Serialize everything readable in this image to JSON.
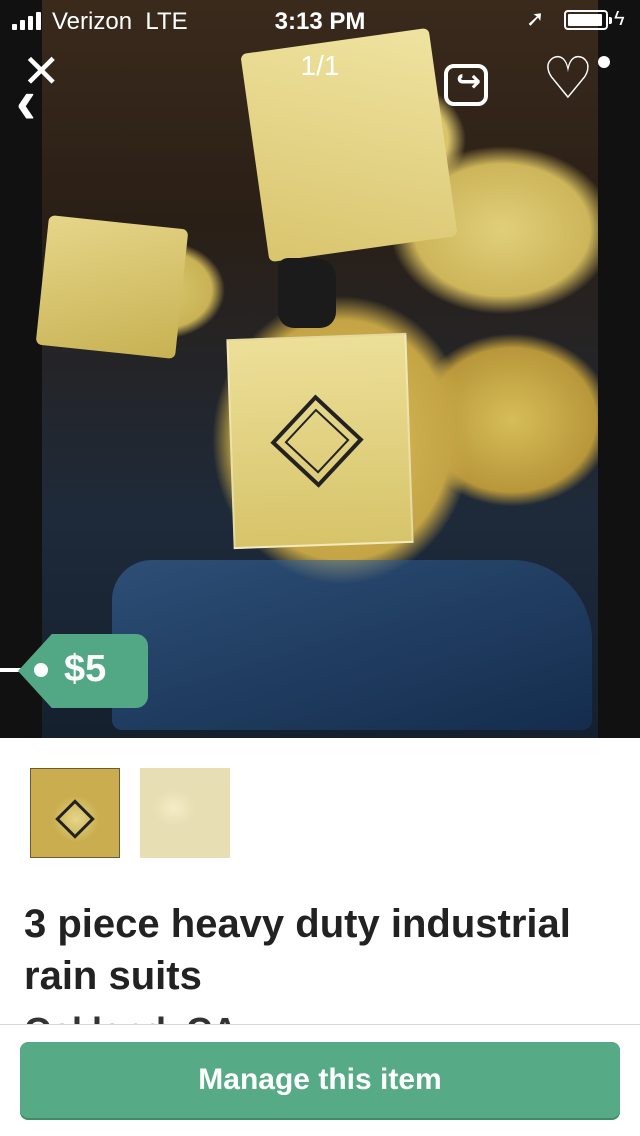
{
  "status_bar": {
    "carrier": "Verizon",
    "network": "LTE",
    "time": "3:13 PM"
  },
  "photo": {
    "counter": "1/1",
    "price": "$5"
  },
  "listing": {
    "title": "3 piece heavy duty industrial rain suits",
    "location": "Oakland, CA"
  },
  "actions": {
    "manage_label": "Manage this item"
  },
  "icons": {
    "close": "close-icon",
    "back": "chevron-left-icon",
    "share": "share-icon",
    "favorite": "heart-icon"
  },
  "colors": {
    "accent": "#56aa86",
    "price_tag": "#52a884"
  }
}
